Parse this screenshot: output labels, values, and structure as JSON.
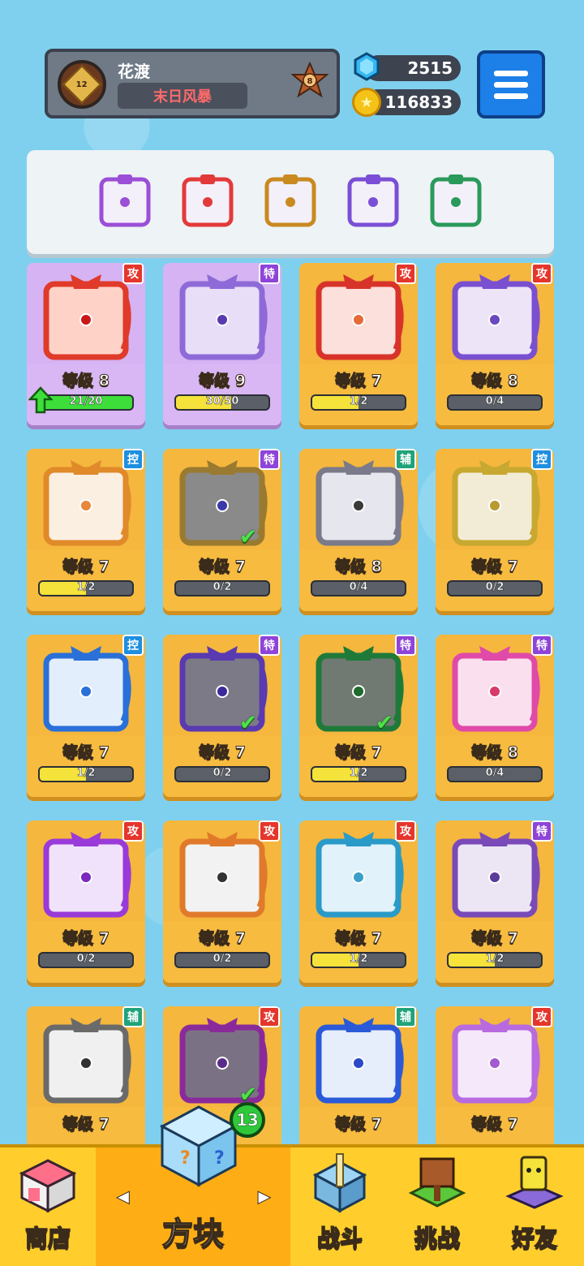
{
  "profile": {
    "name": "花渡",
    "title": "末日风暴",
    "avatar_level": "12",
    "rank": "8"
  },
  "resources": {
    "gems": "2515",
    "coins": "116833"
  },
  "deck": [
    {
      "color": "#9b4fd6",
      "icon": "combo-block-icon"
    },
    {
      "color": "#e23a3a",
      "icon": "rainbow-block-icon"
    },
    {
      "color": "#c98a20",
      "icon": "infinity-block-icon"
    },
    {
      "color": "#7a4fd6",
      "icon": "spiral-block-icon"
    },
    {
      "color": "#2a9a5a",
      "icon": "pentagram-block-icon"
    }
  ],
  "cards": [
    {
      "name": "fire",
      "tag": "攻",
      "tagType": "atk",
      "level": "等级 8",
      "progress": "21/20",
      "fill": 1.0,
      "bg": "purple",
      "frame": "#e03a2a",
      "art": "#ffd2c8",
      "dot": "#c81818",
      "upgradable": true,
      "checked": false
    },
    {
      "name": "lightning",
      "tag": "特",
      "tagType": "spc",
      "level": "等级 9",
      "progress": "30/50",
      "fill": 0.6,
      "bg": "purple",
      "frame": "#8e6ad8",
      "art": "#e8def8",
      "dot": "#5a3ab0",
      "upgradable": false,
      "checked": false
    },
    {
      "name": "burst",
      "tag": "攻",
      "tagType": "atk",
      "level": "等级 7",
      "progress": "1/2",
      "fill": 0.5,
      "bg": "orange",
      "frame": "#d8332a",
      "art": "#fbe0dc",
      "dot": "#e86a38",
      "upgradable": false,
      "checked": false
    },
    {
      "name": "gear",
      "tag": "攻",
      "tagType": "atk",
      "level": "等级 8",
      "progress": "0/4",
      "fill": 0,
      "bg": "orange",
      "frame": "#7a4fd0",
      "art": "#ede4f8",
      "dot": "#6a48c0",
      "upgradable": false,
      "checked": false
    },
    {
      "name": "wind",
      "tag": "控",
      "tagType": "ctl",
      "level": "等级 7",
      "progress": "1/2",
      "fill": 0.5,
      "bg": "orange",
      "frame": "#e08a2a",
      "art": "#fbefe2",
      "dot": "#e8883a",
      "upgradable": false,
      "checked": false
    },
    {
      "name": "infinity",
      "tag": "特",
      "tagType": "spc",
      "level": "等级 7",
      "progress": "0/2",
      "fill": 0,
      "bg": "orange",
      "frame": "#9a7a30",
      "art": "#8a8a8a",
      "dot": "#3a3aa8",
      "upgradable": false,
      "checked": true
    },
    {
      "name": "jaw",
      "tag": "辅",
      "tagType": "sup",
      "level": "等级 8",
      "progress": "0/4",
      "fill": 0,
      "bg": "orange",
      "frame": "#7a7a8a",
      "art": "#e6e6ee",
      "dot": "#3a3a3a",
      "upgradable": false,
      "checked": false
    },
    {
      "name": "shield",
      "tag": "控",
      "tagType": "ctl",
      "level": "等级 7",
      "progress": "0/2",
      "fill": 0,
      "bg": "orange",
      "frame": "#c8a830",
      "art": "#f2ecd6",
      "dot": "#b89a30",
      "upgradable": false,
      "checked": false
    },
    {
      "name": "snow",
      "tag": "控",
      "tagType": "ctl",
      "level": "等级 7",
      "progress": "1/2",
      "fill": 0.5,
      "bg": "orange",
      "frame": "#2a70d8",
      "art": "#e2eefc",
      "dot": "#2a70d8",
      "upgradable": false,
      "checked": false
    },
    {
      "name": "spiral",
      "tag": "特",
      "tagType": "spc",
      "level": "等级 7",
      "progress": "0/2",
      "fill": 0,
      "bg": "orange",
      "frame": "#5a3ab0",
      "art": "#7d7a88",
      "dot": "#3a2a9a",
      "upgradable": false,
      "checked": true
    },
    {
      "name": "pentagram",
      "tag": "特",
      "tagType": "spc",
      "level": "等级 7",
      "progress": "1/2",
      "fill": 0.5,
      "bg": "orange",
      "frame": "#1f7a3a",
      "art": "#707a72",
      "dot": "#1f6a2e",
      "upgradable": false,
      "checked": true
    },
    {
      "name": "blade",
      "tag": "特",
      "tagType": "spc",
      "level": "等级 8",
      "progress": "0/4",
      "fill": 0,
      "bg": "orange",
      "frame": "#e04aa8",
      "art": "#fae0ee",
      "dot": "#d83a6a",
      "upgradable": false,
      "checked": false
    },
    {
      "name": "orbit",
      "tag": "攻",
      "tagType": "atk",
      "level": "等级 7",
      "progress": "0/2",
      "fill": 0,
      "bg": "orange",
      "frame": "#9a3ad8",
      "art": "#efe2fa",
      "dot": "#7a2ac0",
      "upgradable": false,
      "checked": false
    },
    {
      "name": "gun",
      "tag": "攻",
      "tagType": "atk",
      "level": "等级 7",
      "progress": "0/2",
      "fill": 0,
      "bg": "orange",
      "frame": "#e07a2a",
      "art": "#f2f2f2",
      "dot": "#333333",
      "upgradable": false,
      "checked": false
    },
    {
      "name": "vortex",
      "tag": "攻",
      "tagType": "atk",
      "level": "等级 7",
      "progress": "1/2",
      "fill": 0.5,
      "bg": "orange",
      "frame": "#2a9ac8",
      "art": "#e2f2fa",
      "dot": "#3aa0c8",
      "upgradable": false,
      "checked": false
    },
    {
      "name": "gravity",
      "tag": "特",
      "tagType": "spc",
      "level": "等级 7",
      "progress": "1/2",
      "fill": 0.5,
      "bg": "orange",
      "frame": "#7a4ab8",
      "art": "#ece6f4",
      "dot": "#5a3a9a",
      "upgradable": false,
      "checked": false
    },
    {
      "name": "clock",
      "tag": "辅",
      "tagType": "sup",
      "level": "等级 7",
      "progress": "",
      "fill": 0,
      "bg": "orange",
      "frame": "#6a6a6a",
      "art": "#f0f0f0",
      "dot": "#333333",
      "upgradable": false,
      "checked": false
    },
    {
      "name": "combo",
      "tag": "攻",
      "tagType": "atk",
      "level": "",
      "progress": "",
      "fill": 0,
      "bg": "orange",
      "frame": "#8a2a9a",
      "art": "#7a7284",
      "dot": "#5a2a8a",
      "upgradable": false,
      "checked": true
    },
    {
      "name": "moon",
      "tag": "辅",
      "tagType": "sup",
      "level": "等级 7",
      "progress": "",
      "fill": 0,
      "bg": "orange",
      "frame": "#2a5ad8",
      "art": "#e6eefc",
      "dot": "#2a4ac8",
      "upgradable": false,
      "checked": false
    },
    {
      "name": "star",
      "tag": "攻",
      "tagType": "atk",
      "level": "等级 7",
      "progress": "",
      "fill": 0,
      "bg": "orange",
      "frame": "#b86ae0",
      "art": "#f4e8fa",
      "dot": "#a45ad0",
      "upgradable": false,
      "checked": false
    }
  ],
  "nav": {
    "shop": "商店",
    "blocks": "方块",
    "battle": "战斗",
    "challenge": "挑战",
    "friends": "好友",
    "badge": "13"
  },
  "colors": {
    "accent": "#ffce2c",
    "sky": "#7fd0ee"
  }
}
